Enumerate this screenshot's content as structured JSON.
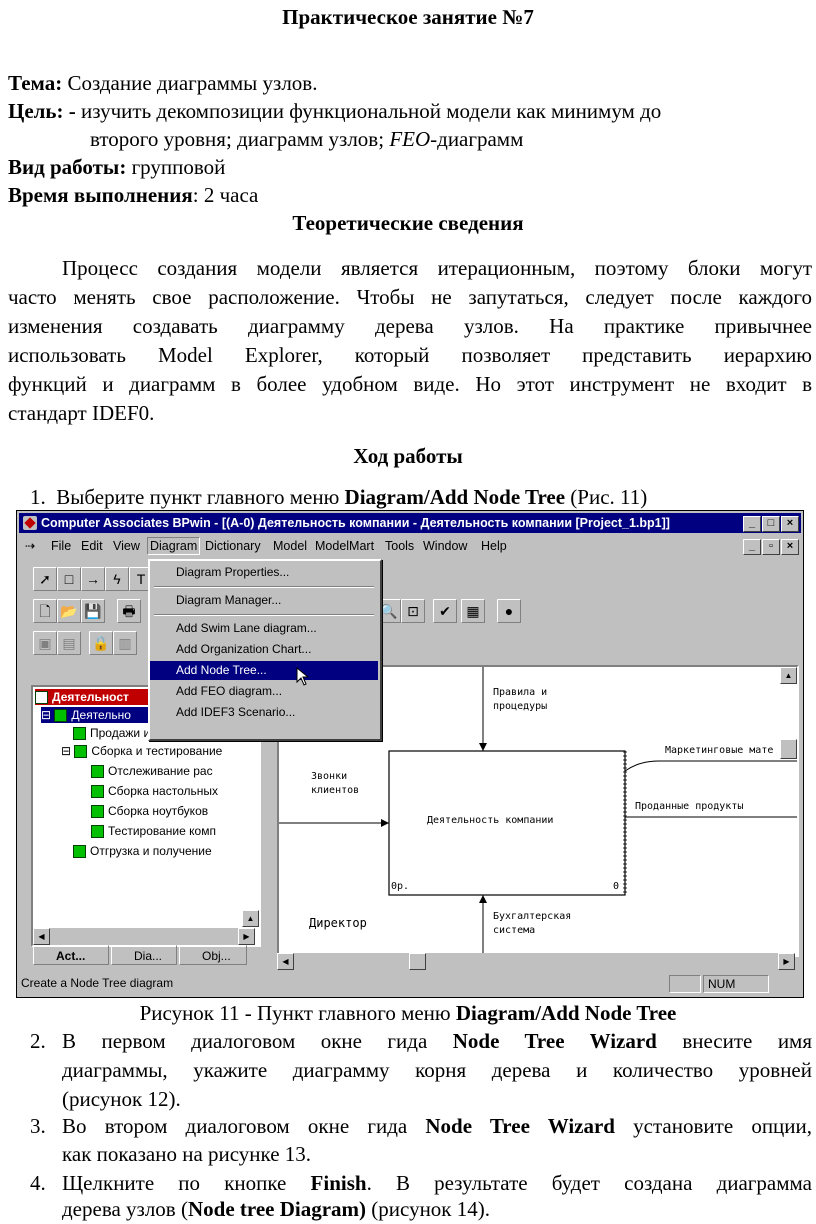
{
  "heading": "Практическое занятие №7",
  "topic": {
    "label": "Тема:",
    "text": "Создание диаграммы узлов."
  },
  "goal": {
    "label": "Цель: -",
    "line1": "изучить декомпозиции функциональной модели как минимум до",
    "line2_a": "второго уровня; диаграмм узлов;",
    "line2_italic": "FEO",
    "line2_b": "-диаграмм"
  },
  "work_type": {
    "label": "Вид работы:",
    "text": "групповой"
  },
  "duration": {
    "label": "Время выполнения",
    "text": ": 2 часа"
  },
  "theory_heading": "Теоретические сведения",
  "theory_lines": [
    "Процесс создания модели является итерационным, поэтому блоки могут",
    "часто менять свое расположение. Чтобы не запутаться, следует после каждого",
    "изменения создавать диаграмму дерева узлов. На практике привычнее",
    "использовать Model Explorer, который позволяет представить иерархию",
    "функций и диаграмм в более удобном виде. Но этот инструмент не входит в",
    "стандарт IDEF0."
  ],
  "progress_heading": "Ход работы",
  "step1": {
    "num": "1.",
    "a": "Выберите пункт главного меню",
    "bold": "Diagram/Add Node Tree",
    "b": "(Рис. 11)"
  },
  "screenshot": {
    "title": "Computer Associates BPwin - [(A-0) Деятельность компании - Деятельность компании  [Project_1.bp1]]",
    "menu": [
      "File",
      "Edit",
      "View",
      "Diagram",
      "Dictionary",
      "Model",
      "ModelMart",
      "Tools",
      "Window",
      "Help"
    ],
    "dropdown": [
      "Diagram Properties...",
      "Diagram Manager...",
      "Add Swim Lane diagram...",
      "Add Organization Chart...",
      "Add Node Tree...",
      "Add FEO diagram...",
      "Add IDEF3 Scenario..."
    ],
    "tree": [
      "Деятельност",
      "Деятельно",
      "Продажи и маркетинг",
      "Сборка и тестирование",
      "Отслеживание рас",
      "Сборка настольных",
      "Сборка ноутбуков",
      "Тестирование комп",
      "Отгрузка и получение"
    ],
    "canvas": {
      "box_label": "Деятельность компании",
      "box_corner_left": "0р.",
      "box_corner_right": "0",
      "control_1": "Правила и",
      "control_2": "процедуры",
      "input_1": "Звонки",
      "input_2": "клиентов",
      "output_1": "Маркетинговые мате",
      "output_2": "Проданные продукты",
      "mech_1": "Бухгалтерская",
      "mech_2": "система",
      "director": "Директор"
    },
    "tabs": [
      "Act...",
      "Dia...",
      "Obj..."
    ],
    "status": "Create a Node Tree diagram",
    "num": "NUM"
  },
  "caption": {
    "a": "Рисунок 11 - Пункт главного меню",
    "bold": "Diagram/Add Node Tree"
  },
  "step2": {
    "num": "2.",
    "l1_a": "В первом диалоговом окне гида",
    "l1_bold": "Node Tree Wizard",
    "l1_b": "внесите имя",
    "l2": "диаграммы, укажите диаграмму корня дерева и количество уровней",
    "l3": "(рисунок 12)."
  },
  "step3": {
    "num": "3.",
    "l1_a": "Во втором диалоговом окне гида",
    "l1_bold": "Node Tree Wizard",
    "l1_b": "установите опции,",
    "l2": "как показано на рисунке 13."
  },
  "step4": {
    "num": "4.",
    "l1_a": "Щелкните по кнопке",
    "l1_bold": "Finish",
    "l1_b": ". В результате будет создана диаграмма",
    "l2_a": "дерева узлов (",
    "l2_bold": "Node tree Diagram)",
    "l2_b": "(рисунок 14)."
  }
}
